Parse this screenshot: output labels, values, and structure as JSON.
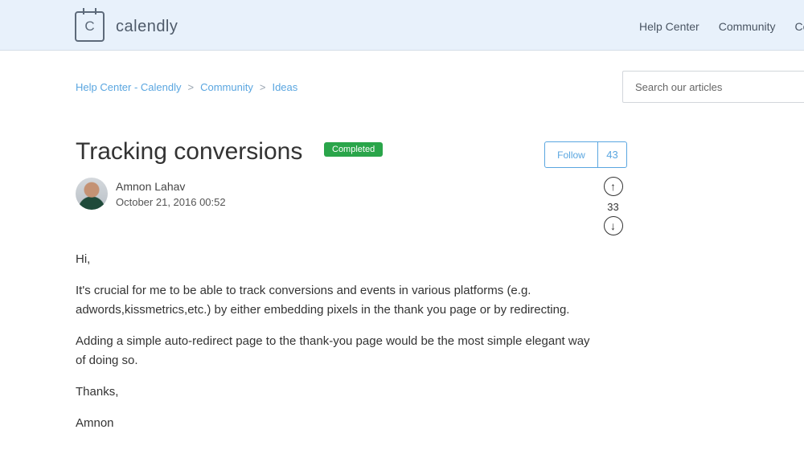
{
  "header": {
    "logo_letter": "C",
    "logo_text": "calendly",
    "nav": [
      "Help Center",
      "Community",
      "Co"
    ]
  },
  "breadcrumb": {
    "items": [
      "Help Center - Calendly",
      "Community",
      "Ideas"
    ],
    "separator": ">"
  },
  "search": {
    "placeholder": "Search our articles",
    "value": ""
  },
  "post": {
    "title": "Tracking conversions",
    "status_badge": "Completed",
    "status_color": "#2aa54a",
    "follow_label": "Follow",
    "follow_count": "43",
    "vote_sum": "33",
    "upvote_icon": "↑",
    "downvote_icon": "↓",
    "author_name": "Amnon Lahav",
    "date": "October 21, 2016 00:52",
    "paragraphs": [
      "Hi,",
      "It's crucial for me to be able to track conversions and events in various platforms (e.g. adwords,kissmetrics,etc.) by either embedding pixels in the thank you page or by redirecting.",
      "Adding a simple auto-redirect page to the thank-you page would be the most simple elegant way of doing so.",
      "Thanks,",
      "Amnon"
    ]
  },
  "colors": {
    "accent": "#5aa6e0",
    "header_bg": "#e8f1fb"
  }
}
